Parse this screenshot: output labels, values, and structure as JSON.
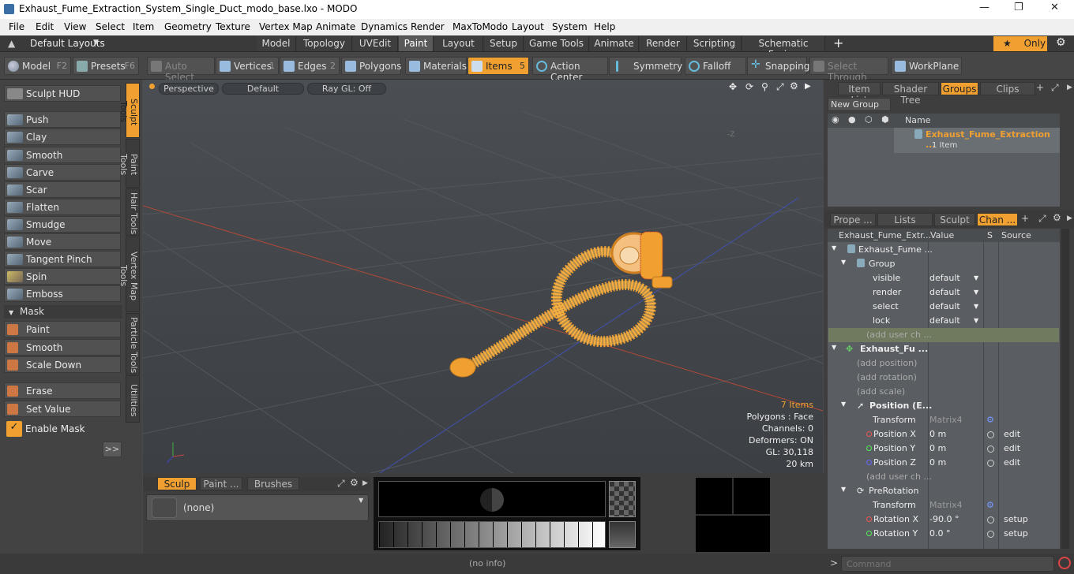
{
  "window": {
    "title": "Exhaust_Fume_Extraction_System_Single_Duct_modo_base.lxo - MODO"
  },
  "menu": [
    "File",
    "Edit",
    "View",
    "Select",
    "Item",
    "Geometry",
    "Texture",
    "Vertex Map",
    "Animate",
    "Dynamics",
    "Render",
    "MaxToModo",
    "Layout",
    "System",
    "Help"
  ],
  "layoutbar": {
    "default_layouts": "Default Layouts",
    "tabs": [
      "Model",
      "Topology",
      "UVEdit",
      "Paint",
      "Layout",
      "Setup",
      "Game Tools",
      "Animate",
      "Render",
      "Scripting",
      "Schematic Fusion"
    ],
    "active_tab": "Paint",
    "add": "+",
    "only": "Only"
  },
  "toolbar": {
    "model": "Model",
    "model_key": "F2",
    "presets": "Presets",
    "presets_key": "F6",
    "auto_select": "Auto Select",
    "vertices": "Vertices",
    "vertices_key": "1",
    "edges": "Edges",
    "edges_key": "2",
    "polygons": "Polygons",
    "materials": "Materials",
    "items": "Items",
    "items_key": "5",
    "action_center": "Action Center",
    "symmetry": "Symmetry",
    "falloff": "Falloff",
    "snapping": "Snapping",
    "select_through": "Select Through",
    "workplane": "WorkPlane"
  },
  "left": {
    "sculpt_hud": "Sculpt HUD",
    "tools": [
      "Push",
      "Clay",
      "Smooth",
      "Carve",
      "Scar",
      "Flatten",
      "Smudge",
      "Move",
      "Tangent Pinch",
      "Spin",
      "Emboss"
    ],
    "mask_header": "Mask",
    "mask_tools": [
      "Paint",
      "Smooth",
      "Scale Down"
    ],
    "erase": "Erase",
    "set_value": "Set Value",
    "enable_mask": "Enable Mask",
    "more": ">>",
    "vtabs": [
      "Sculpt Tools",
      "Paint Tools",
      "Hair Tools",
      "Vertex Map Tools",
      "Particle Tools",
      "Utilities"
    ]
  },
  "viewport": {
    "perspective": "Perspective",
    "default": "Default",
    "raygl": "Ray GL: Off",
    "stats": {
      "items": "7 Items",
      "polygons": "Polygons : Face",
      "channels": "Channels: 0",
      "deformers": "Deformers: ON",
      "gl": "GL: 30,118",
      "scale": "20 km"
    },
    "colors": {
      "mesh": "#f0a030",
      "x_axis": "#c04030",
      "z_axis": "#3050c0"
    }
  },
  "groups_panel": {
    "tabs": [
      "Item List",
      "Shader Tree",
      "Groups",
      "Clips"
    ],
    "active_tab": "Groups",
    "new_group": "New Group",
    "name_header": "Name",
    "group_name": "Exhaust_Fume_Extraction ...",
    "group_count": "1 Item"
  },
  "channels_panel": {
    "tabs": [
      "Prope ...",
      "Lists",
      "Sculpt",
      "Chan ..."
    ],
    "active_tab": "Chan ...",
    "headers": {
      "name": "Exhaust_Fume_Extr...",
      "value": "Value",
      "s": "S",
      "source": "Source"
    },
    "rows": [
      {
        "name": "Exhaust_Fume ...",
        "value": "",
        "source": ""
      },
      {
        "name": "Group",
        "value": "",
        "source": ""
      },
      {
        "name": "visible",
        "value": "default",
        "source": ""
      },
      {
        "name": "render",
        "value": "default",
        "source": ""
      },
      {
        "name": "select",
        "value": "default",
        "source": ""
      },
      {
        "name": "lock",
        "value": "default",
        "source": ""
      },
      {
        "name": "(add user ch ...",
        "value": "",
        "source": ""
      },
      {
        "name": "Exhaust_Fu ...",
        "value": "",
        "source": ""
      },
      {
        "name": "(add position)",
        "value": "",
        "source": ""
      },
      {
        "name": "(add rotation)",
        "value": "",
        "source": ""
      },
      {
        "name": "(add scale)",
        "value": "",
        "source": ""
      },
      {
        "name": "Position (E...",
        "value": "",
        "source": ""
      },
      {
        "name": "Transform",
        "value": "Matrix4",
        "source": ""
      },
      {
        "name": "Position X",
        "value": "0 m",
        "source": "edit"
      },
      {
        "name": "Position Y",
        "value": "0 m",
        "source": "edit"
      },
      {
        "name": "Position Z",
        "value": "0 m",
        "source": "edit"
      },
      {
        "name": "(add user ch ...",
        "value": "",
        "source": ""
      },
      {
        "name": "PreRotation",
        "value": "",
        "source": ""
      },
      {
        "name": "Transform",
        "value": "Matrix4",
        "source": ""
      },
      {
        "name": "Rotation X",
        "value": "-90.0 °",
        "source": "setup"
      },
      {
        "name": "Rotation Y",
        "value": "0.0 °",
        "source": "setup"
      }
    ]
  },
  "bottom": {
    "tabs": [
      "Sculp ...",
      "Paint ...",
      "Brushes"
    ],
    "active_tab": "Sculp ...",
    "preset": "(none)",
    "status": "(no info)",
    "command_placeholder": "Command"
  }
}
